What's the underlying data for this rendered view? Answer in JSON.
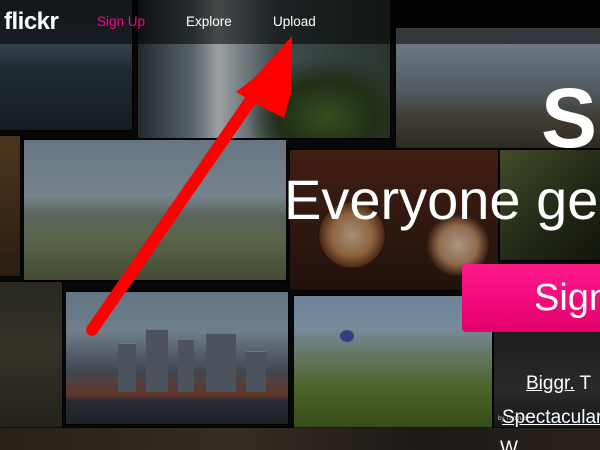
{
  "nav": {
    "logo": "flickr",
    "signup": "Sign Up",
    "explore": "Explore",
    "upload": "Upload"
  },
  "hero": {
    "title_fragment": "S",
    "subtitle_fragment": "Everyone ge"
  },
  "cta": {
    "label": "Sign"
  },
  "features": [
    {
      "key": "Biggr.",
      "rest": " T"
    },
    {
      "key": "Spectacular",
      "rest": ""
    },
    {
      "key": "W",
      "rest": ""
    }
  ],
  "colors": {
    "brand_pink": "#ff0084",
    "arrow_red": "#ff0000"
  },
  "photo_credit": "by Thomas"
}
